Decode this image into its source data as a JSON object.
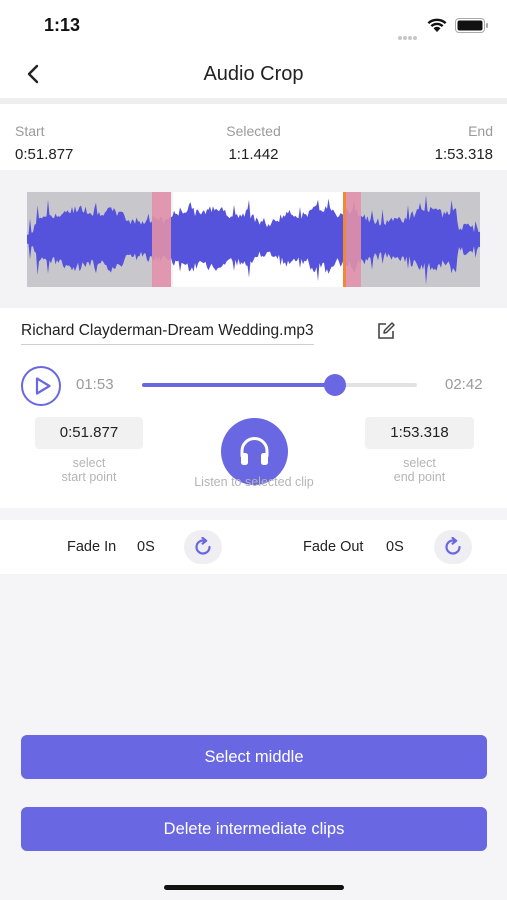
{
  "status_bar": {
    "time": "1:13"
  },
  "nav": {
    "title": "Audio Crop",
    "back_icon": "chevron-left-icon"
  },
  "range": {
    "start_label": "Start",
    "start_value": "0:51.877",
    "selected_label": "Selected",
    "selected_value": "1:1.442",
    "end_label": "End",
    "end_value": "1:53.318"
  },
  "player": {
    "filename": "Richard Clayderman-Dream Wedding.mp3",
    "current_time": "01:53",
    "total_time": "02:42",
    "progress_fraction": 0.7,
    "start_point_value": "0:51.877",
    "start_point_caption_1": "select",
    "start_point_caption_2": "start point",
    "end_point_value": "1:53.318",
    "end_point_caption_1": "select",
    "end_point_caption_2": "end point",
    "listen_caption": "Listen to selected clip"
  },
  "fade": {
    "in_label": "Fade In",
    "in_value": "0S",
    "out_label": "Fade Out",
    "out_value": "0S"
  },
  "buttons": {
    "select_middle": "Select middle",
    "delete_intermediate": "Delete intermediate clips"
  },
  "colors": {
    "accent": "#6a67e3",
    "waveform": "#5552dc",
    "marker": "#e08fa8",
    "playhead": "#f0883a",
    "unselected_bg": "#c8c8cc"
  },
  "waveform": {
    "selection_start_fraction": 0.32,
    "selection_end_fraction": 0.7
  }
}
